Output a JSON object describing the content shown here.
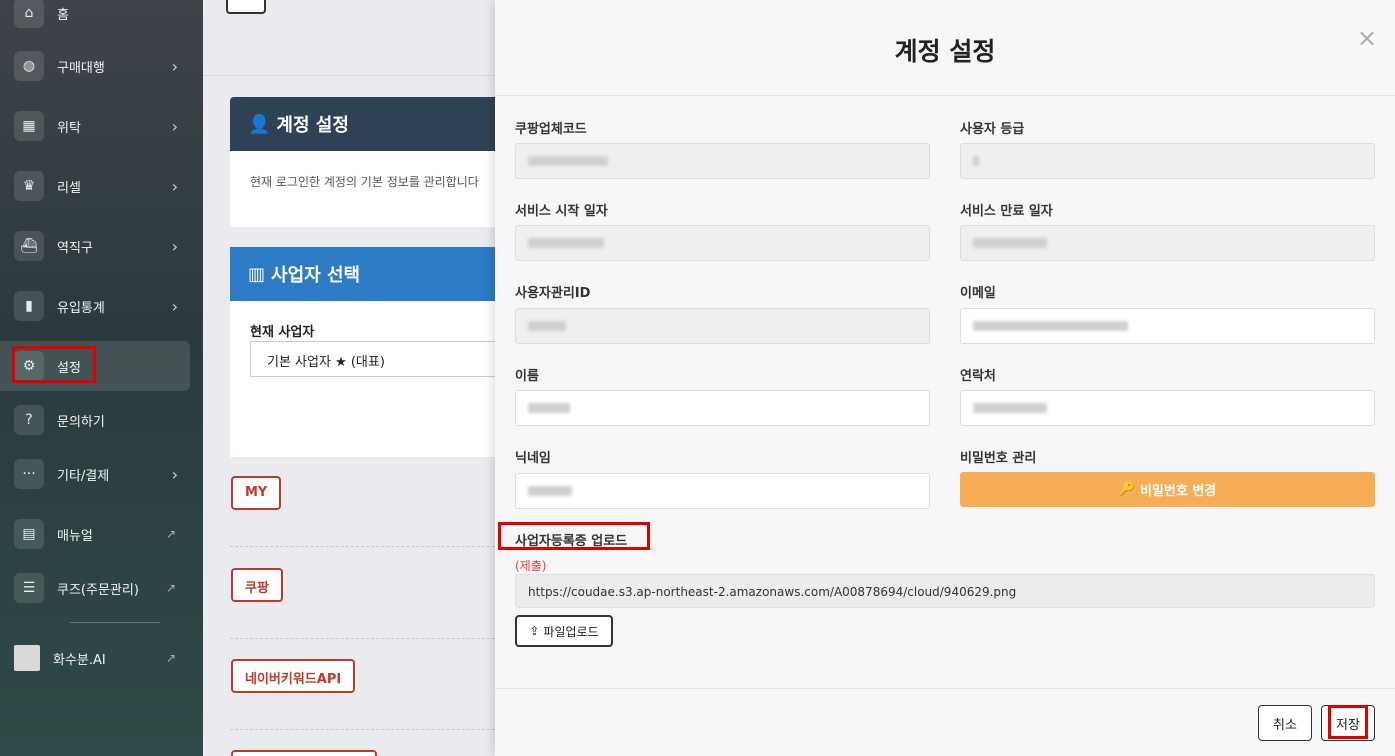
{
  "sidebar": {
    "items": [
      {
        "label": "홈",
        "icon": "home-icon"
      },
      {
        "label": "구매대행",
        "icon": "globe-icon"
      },
      {
        "label": "위탁",
        "icon": "store-icon"
      },
      {
        "label": "리셀",
        "icon": "crown-icon"
      },
      {
        "label": "역직구",
        "icon": "ship-icon"
      },
      {
        "label": "유입통계",
        "icon": "bar-chart-icon"
      },
      {
        "label": "설정",
        "icon": "gear-icon"
      },
      {
        "label": "문의하기",
        "icon": "question-icon"
      },
      {
        "label": "기타/결제",
        "icon": "more-icon"
      },
      {
        "label": "매뉴얼",
        "icon": "book-icon"
      },
      {
        "label": "쿠즈(주문관리)",
        "icon": "list-check-icon"
      },
      {
        "label": "화수분.AI",
        "icon": "ai-logo-icon"
      }
    ]
  },
  "background": {
    "account_card_title": "계정 설정",
    "account_card_text": "현재 로그인한 계정의 기본 정보를 관리합니다",
    "business_card_title": "사업자 선택",
    "current_business_label": "현재 사업자",
    "current_business_value": "기본 사업자 ★ (대표)",
    "tags": [
      "MY",
      "쿠팡",
      "네이버키워드API"
    ]
  },
  "modal": {
    "title": "계정 설정",
    "close_icon": "×",
    "fields": {
      "coupang_code_label": "쿠팡업체코드",
      "user_grade_label": "사용자 등급",
      "service_start_label": "서비스 시작 일자",
      "service_end_label": "서비스 만료 일자",
      "admin_id_label": "사용자관리ID",
      "email_label": "이메일",
      "name_label": "이름",
      "contact_label": "연락처",
      "nickname_label": "닉네임",
      "password_label": "비밀번호 관리",
      "password_button": "비밀번호 변경"
    },
    "business_upload": {
      "label": "사업자등록증 업로드",
      "status": "(제출)",
      "url": "https://coudae.s3.ap-northeast-2.amazonaws.com/A00878694/cloud/940629.png",
      "upload_button": "파일업로드"
    },
    "footer": {
      "cancel": "취소",
      "save": "저장"
    }
  },
  "colors": {
    "accent_orange": "#f6ad55",
    "highlight_red": "#e00000",
    "status_red": "#e53e3e"
  }
}
